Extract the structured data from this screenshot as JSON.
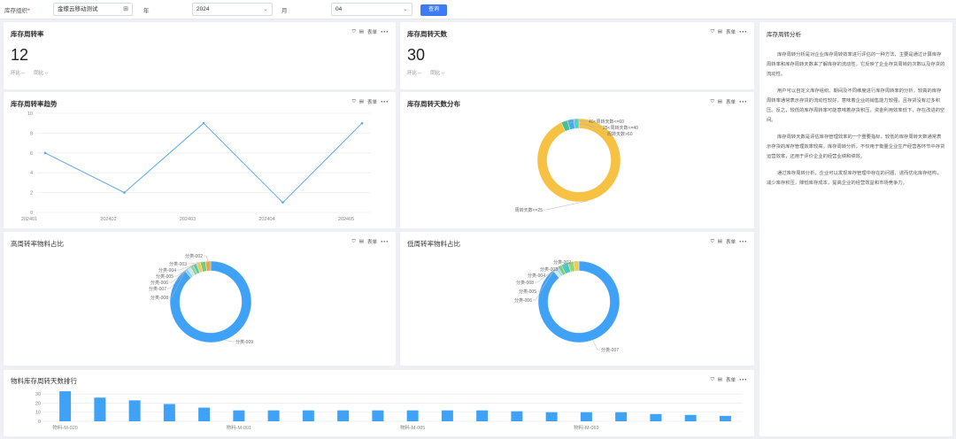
{
  "filters": {
    "org_label": "库存组织",
    "org_required": "*",
    "org_value": "金蝶云移动测试",
    "year_label": "年",
    "year_value": "2024",
    "month_label": "月",
    "month_value": "04",
    "query_label": "查询"
  },
  "toolbar": {
    "table_label": "表单"
  },
  "kpi_rate": {
    "title": "库存周转率",
    "value": "12",
    "mom": "环比 --",
    "yoy": "同比 --"
  },
  "kpi_days": {
    "title": "库存周转天数",
    "value": "30",
    "mom": "环比 --",
    "yoy": "同比 --"
  },
  "trend": {
    "title": "库存周转率趋势"
  },
  "days_dist": {
    "title": "库存周转天数分布"
  },
  "high_ratio": {
    "title": "高周转率物料占比"
  },
  "low_ratio": {
    "title": "低周转率物料占比"
  },
  "ranking": {
    "title": "物料库存周转天数排行"
  },
  "analysis": {
    "title": "库存周转分析",
    "paragraphs": [
      "库存周转分析是对企业库存周转效率进行评估的一种方法，主要是通过计算库存周转率和库存周转天数来了解库存的流动性，它反映了企业存货周转的次数以及存货的流动性。",
      "用户可以自定义库存组织、期间及不同维度进行库存周转率的分析，较高的库存周转率通常表示存货的流动性较好，意味着企业的销售能力较强，且存货没有过多积压。反之，较低的库存周转率可能意味着存货积压，资金利用效率低下，存在改进的空间。",
      "库存周转天数是评估库存管理效率的一个重要指标，较低的库存周转天数通常表示存货的库存管理效率较高。库存周转分析，不仅用于衡量企业生产经营各环节中存货运营效率，还用于评价企业的经营业绩和绩效。",
      "通过库存周转分析，企业可以发现库存管理中存在的问题，进而优化库存结构，减少库存积压，降低库存成本，提高企业的经营效益和市场竞争力。"
    ]
  },
  "chart_data": [
    {
      "type": "line",
      "title": "库存周转率趋势",
      "categories": [
        "202401",
        "202402",
        "202403",
        "202404",
        "202405"
      ],
      "values": [
        6,
        2,
        9,
        1,
        9
      ],
      "ylim": [
        0,
        10
      ],
      "yticks": [
        0,
        2,
        4,
        6,
        8,
        10
      ],
      "grid": true,
      "color": "#5aa9ea"
    },
    {
      "type": "pie",
      "title": "库存周转天数分布",
      "donut": true,
      "labels": [
        "周转天数<=25",
        "25<周转天数<=40",
        "40<周转天数<=60",
        "周转天数>60"
      ],
      "values": [
        93,
        2.5,
        2.5,
        2
      ],
      "colors": [
        "#f7c244",
        "#44c28e",
        "#4aa8ef",
        "#46d3d0"
      ]
    },
    {
      "type": "pie",
      "title": "高周转率物料占比",
      "donut": true,
      "labels": [
        "分类-009",
        "分类-008",
        "分类-007",
        "分类-006",
        "分类-005",
        "分类-004",
        "分类-003",
        "分类-002"
      ],
      "values": [
        89,
        1.3,
        1.3,
        1.3,
        1.4,
        1.6,
        2.1,
        2
      ],
      "colors": [
        "#3fa2f7",
        "#8fd0ff",
        "#c4e6ff",
        "#9ad27a",
        "#50c7c2",
        "#f5c94d",
        "#7cc97d",
        "#f0a53e"
      ]
    },
    {
      "type": "pie",
      "title": "低周转率物料占比",
      "donut": true,
      "labels": [
        "分类-007",
        "分类-006",
        "分类-005",
        "分类-008",
        "分类-004",
        "分类-003",
        "分类-002"
      ],
      "values": [
        89,
        1.2,
        1.2,
        1.5,
        2.8,
        2.3,
        2
      ],
      "colors": [
        "#3fa2f7",
        "#d2ecff",
        "#a8daff",
        "#7fd06e",
        "#46c9c5",
        "#9ed46e",
        "#f5c94d"
      ]
    },
    {
      "type": "bar",
      "title": "物料库存周转天数排行",
      "categories": [
        "物料-M-020",
        "",
        "",
        "",
        "",
        "物料-M-001",
        "",
        "",
        "",
        "",
        "物料-M-005",
        "",
        "",
        "",
        "",
        "物料-M-069",
        "",
        "",
        "",
        ""
      ],
      "values": [
        33,
        26,
        23,
        19,
        15,
        12,
        12,
        12,
        12,
        12,
        12,
        12,
        12,
        11,
        10,
        10,
        10,
        8,
        7,
        6
      ],
      "ylim": [
        0,
        35
      ],
      "yticks": [
        0,
        10,
        20,
        30
      ],
      "color": "#3fa2f7"
    }
  ]
}
